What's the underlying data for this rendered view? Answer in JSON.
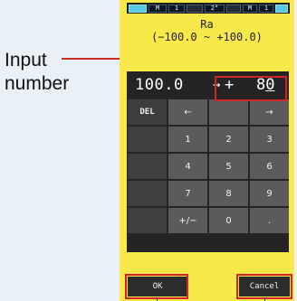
{
  "callout": {
    "label": "Input\nnumber"
  },
  "status_bar": {
    "segments": [
      "",
      "M",
      "1",
      "",
      "2°",
      "",
      "M",
      "1",
      ""
    ]
  },
  "header": {
    "title_line1": "Ra",
    "title_line2": "(−100.0 ~ +100.0)"
  },
  "display": {
    "current_value": "100.0",
    "arrow": "→",
    "sign": "+",
    "input_value": "8",
    "cursor_digit": "0"
  },
  "keypad": {
    "rows": [
      [
        "DEL",
        "←",
        "",
        "→"
      ],
      [
        "",
        "1",
        "2",
        "3"
      ],
      [
        "",
        "4",
        "5",
        "6"
      ],
      [
        "",
        "7",
        "8",
        "9"
      ],
      [
        "",
        "+/−",
        "0",
        "."
      ]
    ]
  },
  "softkeys": {
    "ok_label": "OK",
    "cancel_label": "Cancel"
  },
  "colors": {
    "screen_bg": "#f9e84a",
    "panel_bg": "#242424",
    "key_bg": "#5b5b5b",
    "highlight": "#d1232a"
  }
}
